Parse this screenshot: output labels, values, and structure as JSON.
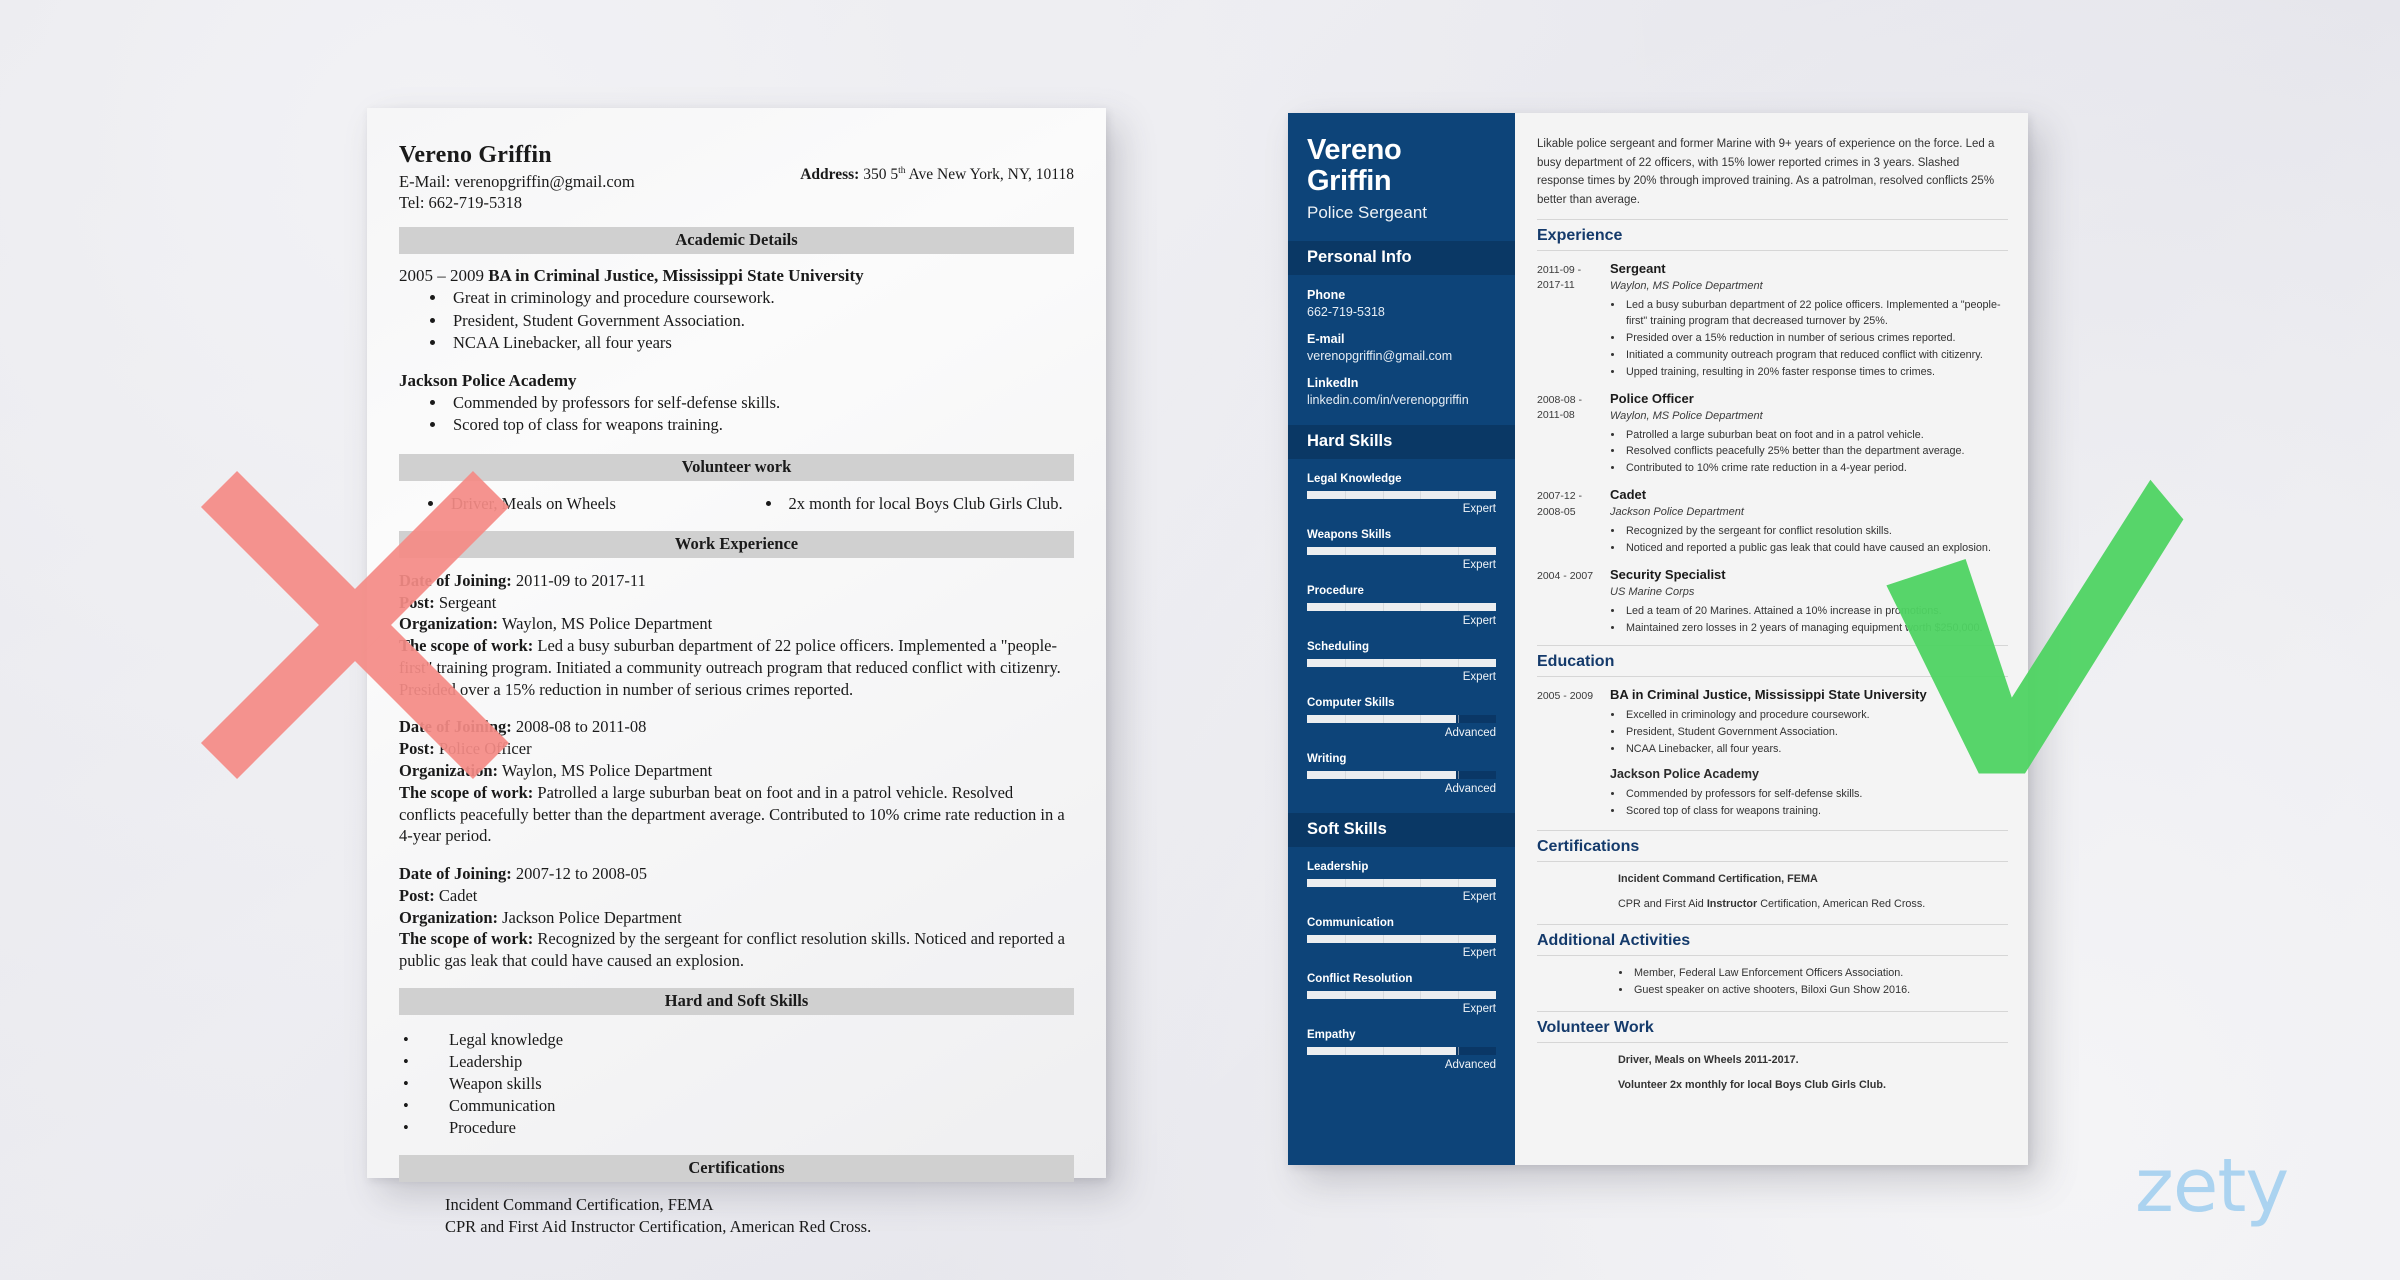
{
  "bad_resume": {
    "name": "Vereno Griffin",
    "email_line": "E-Mail: verenopgriffin@gmail.com",
    "tel_line": "Tel: 662-719-5318",
    "address_label": "Address:",
    "address_value_pre": "350 5",
    "address_sup": "th",
    "address_value_post": " Ave New York, NY, 10118",
    "sections": {
      "academic": "Academic Details",
      "volunteer": "Volunteer work",
      "work": "Work Experience",
      "skills": "Hard and Soft Skills",
      "certifications": "Certifications"
    },
    "education": {
      "years": "2005 – 2009 ",
      "degree": "BA in Criminal Justice, Mississippi State University",
      "bullets": [
        "Great in criminology and procedure coursework.",
        "President, Student Government Association.",
        "NCAA Linebacker, all four years"
      ],
      "academy": "Jackson Police Academy",
      "academy_bullets": [
        "Commended by professors for self-defense skills.",
        "Scored top of class for weapons training."
      ]
    },
    "volunteer_left": "Driver, Meals on Wheels",
    "volunteer_right": "2x month for local Boys Club Girls Club.",
    "jobs": [
      {
        "date_label": "Date of Joining:",
        "date_value": " 2011-09 to 2017-11",
        "post_label": "Post:",
        "post_value": " Sergeant",
        "org_label": "Organization:",
        "org_value": " Waylon, MS Police Department",
        "scope_label": "The scope of work:",
        "scope_value": " Led a busy suburban department of 22 police officers. Implemented a \"people-first\" training program. Initiated a community outreach program that reduced conflict with citizenry. Presided over a 15% reduction in number of serious crimes reported."
      },
      {
        "date_label": "Date of Joining:",
        "date_value": " 2008-08 to 2011-08",
        "post_label": "Post:",
        "post_value": " Police Officer",
        "org_label": "Organization:",
        "org_value": " Waylon, MS Police Department",
        "scope_label": "The scope of work:",
        "scope_value": " Patrolled a large suburban beat on foot and in a patrol vehicle. Resolved conflicts peacefully better than the department average. Contributed to 10% crime rate reduction in a 4-year period."
      },
      {
        "date_label": "Date of Joining:",
        "date_value": " 2007-12 to 2008-05",
        "post_label": "Post:",
        "post_value": " Cadet",
        "org_label": "Organization:",
        "org_value": " Jackson Police Department",
        "scope_label": "The scope of work:",
        "scope_value": " Recognized by the sergeant for conflict resolution skills. Noticed and reported a public gas leak that could have caused an explosion."
      }
    ],
    "skills": [
      "Legal knowledge",
      "Leadership",
      "Weapon skills",
      "Communication",
      "Procedure"
    ],
    "certs": [
      "Incident Command Certification, FEMA",
      "CPR and First Aid Instructor Certification, American Red Cross."
    ]
  },
  "good_resume": {
    "name_line1": "Vereno",
    "name_line2": "Griffin",
    "job_title": "Police Sergeant",
    "sidebar": {
      "personal_info_heading": "Personal Info",
      "fields": [
        {
          "label": "Phone",
          "value": "662-719-5318"
        },
        {
          "label": "E-mail",
          "value": "verenopgriffin@gmail.com"
        },
        {
          "label": "LinkedIn",
          "value": "linkedin.com/in/verenopgriffin"
        }
      ],
      "hard_skills_heading": "Hard Skills",
      "hard_skills": [
        {
          "label": "Legal Knowledge",
          "level": "Expert",
          "pct": 100
        },
        {
          "label": "Weapons Skills",
          "level": "Expert",
          "pct": 100
        },
        {
          "label": "Procedure",
          "level": "Expert",
          "pct": 100
        },
        {
          "label": "Scheduling",
          "level": "Expert",
          "pct": 100
        },
        {
          "label": "Computer Skills",
          "level": "Advanced",
          "pct": 79
        },
        {
          "label": "Writing",
          "level": "Advanced",
          "pct": 79
        }
      ],
      "soft_skills_heading": "Soft Skills",
      "soft_skills": [
        {
          "label": "Leadership",
          "level": "Expert",
          "pct": 100
        },
        {
          "label": "Communication",
          "level": "Expert",
          "pct": 100
        },
        {
          "label": "Conflict Resolution",
          "level": "Expert",
          "pct": 100
        },
        {
          "label": "Empathy",
          "level": "Advanced",
          "pct": 79
        }
      ]
    },
    "summary": "Likable police sergeant and former Marine with 9+ years of experience on the force. Led a busy department of 22 officers, with 15% lower reported crimes in 3 years. Slashed response times by 20% through improved training. As a patrolman, resolved conflicts 25% better than average.",
    "headings": {
      "experience": "Experience",
      "education": "Education",
      "certifications": "Certifications",
      "additional": "Additional Activities",
      "volunteer": "Volunteer Work"
    },
    "experience": [
      {
        "dates": "2011-09 - 2017-11",
        "role": "Sergeant",
        "org": "Waylon, MS Police Department",
        "bullets": [
          "Led a busy suburban department of 22 police officers. Implemented a \"people-first\" training program that decreased turnover by 25%.",
          "Presided over a 15% reduction in number of serious crimes reported.",
          "Initiated a community outreach program that reduced conflict with citizenry.",
          "Upped training, resulting in 20% faster response times to crimes."
        ]
      },
      {
        "dates": "2008-08 - 2011-08",
        "role": "Police Officer",
        "org": "Waylon, MS Police Department",
        "bullets": [
          "Patrolled a large suburban beat on foot and in a patrol vehicle.",
          "Resolved conflicts peacefully 25% better than the department average.",
          "Contributed to 10% crime rate reduction in a 4-year period."
        ]
      },
      {
        "dates": "2007-12 - 2008-05",
        "role": "Cadet",
        "org": "Jackson Police Department",
        "bullets": [
          "Recognized by the sergeant for conflict resolution skills.",
          "Noticed and reported a public gas leak that could have caused an explosion."
        ]
      },
      {
        "dates": "2004 - 2007",
        "role": "Security Specialist",
        "org": "US Marine Corps",
        "bullets": [
          "Led a team of 20 Marines. Attained a 10% increase in promotions.",
          "Maintained zero losses in 2 years of managing equipment worth $250,000."
        ]
      }
    ],
    "education": {
      "dates": "2005 - 2009",
      "degree": "BA in Criminal Justice, Mississippi State University",
      "bullets": [
        "Excelled in criminology and procedure coursework.",
        "President, Student Government Association.",
        "NCAA Linebacker, all four years."
      ],
      "academy": "Jackson Police Academy",
      "academy_bullets": [
        "Commended by professors for self-defense skills.",
        "Scored top of class for weapons training."
      ]
    },
    "certifications": [
      {
        "text": "Incident Command Certification, FEMA",
        "bold": true
      },
      {
        "pre": "CPR and First Aid ",
        "strong": "Instructor",
        "post": " Certification, American Red Cross.",
        "bold": false
      }
    ],
    "additional_activities": [
      "Member, Federal Law Enforcement Officers Association.",
      "Guest speaker on active shooters, Biloxi Gun Show 2016."
    ],
    "volunteer": [
      "Driver, Meals on Wheels 2011-2017.",
      "Volunteer 2x monthly for local Boys Club Girls Club."
    ]
  },
  "marks": {
    "reject_color": "#f58b86",
    "approve_color": "#4fd463"
  },
  "branding": {
    "logo_text": "zety",
    "logo_color": "#a8d2f0"
  }
}
